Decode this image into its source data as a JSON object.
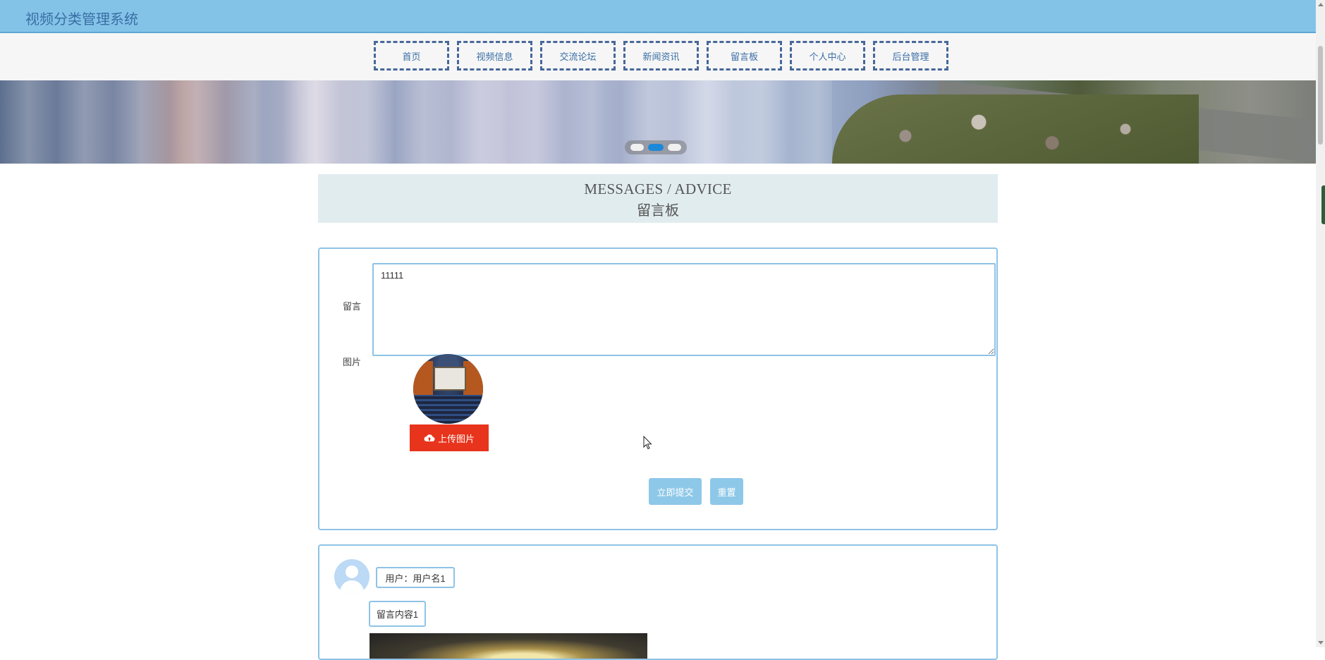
{
  "header": {
    "title": "视频分类管理系统"
  },
  "nav": {
    "items": [
      {
        "label": "首页"
      },
      {
        "label": "视频信息"
      },
      {
        "label": "交流论坛"
      },
      {
        "label": "新闻资讯"
      },
      {
        "label": "留言板"
      },
      {
        "label": "个人中心"
      },
      {
        "label": "后台管理"
      }
    ]
  },
  "banner": {
    "slide_count": 3,
    "active_slide": 2
  },
  "section": {
    "title_en": "MESSAGES / ADVICE",
    "title_cn": "留言板"
  },
  "form": {
    "message_label": "留言",
    "message_value": "11111",
    "image_label": "图片",
    "upload_label": "上传图片",
    "submit_label": "立即提交",
    "reset_label": "重置"
  },
  "comments": [
    {
      "user": "用户：用户名1",
      "content": "留言内容1"
    }
  ],
  "colors": {
    "topbar": "#84c3e8",
    "nav_border": "#47689a",
    "accent_border": "#8ec3e6",
    "upload_button": "#e8341c",
    "action_button": "#8ec8e8",
    "active_dot": "#1e88d8"
  }
}
